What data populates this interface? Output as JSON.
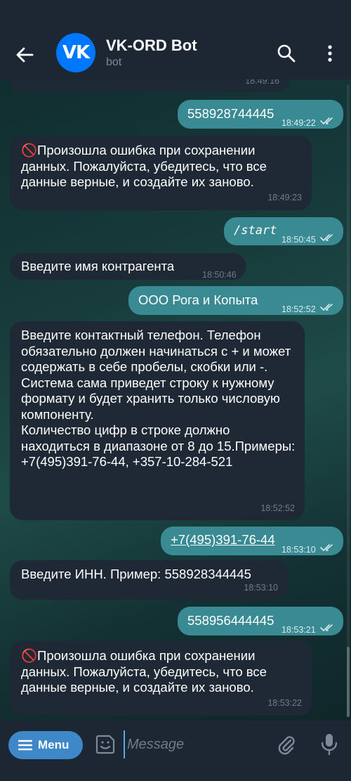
{
  "header": {
    "avatar_text": "VK",
    "title": "VK-ORD Bot",
    "subtitle": "bot"
  },
  "messages": [
    {
      "dir": "in",
      "text": "",
      "time": "18:49:16"
    },
    {
      "dir": "out",
      "text": "558928744445",
      "time": "18:49:22",
      "read": true
    },
    {
      "dir": "in",
      "text": "🚫Произошла ошибка при сохранении данных. Пожалуйста, убедитесь, что все данные верные, и создайте их заново.",
      "time": "18:49:23"
    },
    {
      "dir": "out",
      "text": "/start",
      "time": "18:50:45",
      "read": true
    },
    {
      "dir": "in",
      "text": "Введите имя контрагента",
      "time": "18:50:46"
    },
    {
      "dir": "out",
      "text": "ООО Рога и Копыта",
      "time": "18:52:52",
      "read": true
    },
    {
      "dir": "in",
      "text": "Введите контактный телефон. Телефон обязательно должен начинаться с + и может содержать в себе пробелы, скобки или -.\nСистема сама приведет строку к нужному формату и будет хранить только числовую компоненту.\nКоличество цифр в строке должно находиться в диапазоне от 8 до 15.Примеры: +7(495)391-76-44, +357-10-284-521",
      "time": "18:52:52"
    },
    {
      "dir": "out",
      "text": "+7(495)391-76-44",
      "time": "18:53:10",
      "read": true
    },
    {
      "dir": "in",
      "text": "Введите ИНН. Пример: 558928344445",
      "time": "18:53:10"
    },
    {
      "dir": "out",
      "text": "558956444445",
      "time": "18:53:21",
      "read": true
    },
    {
      "dir": "in",
      "text": "🚫Произошла ошибка при сохранении данных. Пожалуйста, убедитесь, что все данные верные, и создайте их заново.",
      "time": "18:53:22"
    }
  ],
  "composer": {
    "menu_label": "Menu",
    "placeholder": "Message"
  },
  "colors": {
    "header_bg": "#1d2733",
    "incoming_bubble": "#1e2935",
    "outgoing_bubble": "#3a8a93",
    "accent": "#3e88c9",
    "avatar": "#0077ff"
  },
  "icons": [
    "back-arrow-icon",
    "search-icon",
    "more-vertical-icon",
    "sticker-icon",
    "attach-icon",
    "mic-icon",
    "hamburger-icon",
    "double-check-icon"
  ]
}
